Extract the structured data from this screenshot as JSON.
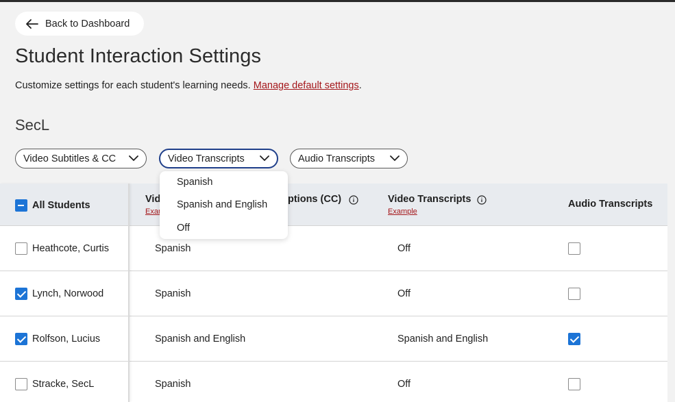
{
  "header": {
    "back_label": "Back to Dashboard",
    "title": "Student Interaction Settings",
    "subtitle": "Customize settings for each student's learning needs. ",
    "manage_link": "Manage default settings",
    "subtitle_end": "."
  },
  "section": {
    "name": "SecL"
  },
  "filters": [
    {
      "label": "Video Subtitles & CC"
    },
    {
      "label": "Video Transcripts"
    },
    {
      "label": "Audio Transcripts"
    }
  ],
  "dropdown": {
    "options": [
      "Spanish",
      "Spanish and English",
      "Off"
    ]
  },
  "table": {
    "all_students_label": "All Students",
    "columns": {
      "subtitles_visible": "Vid",
      "subtitles_example_visible": "Exam",
      "captions_visible": "ptions (CC)",
      "transcripts": "Video Transcripts",
      "transcripts_example": "Example",
      "audio": "Audio Transcripts"
    },
    "rows": [
      {
        "name": "Heathcote, Curtis",
        "checked": false,
        "subtitles": "Spanish",
        "transcripts": "Off",
        "audio": false
      },
      {
        "name": "Lynch, Norwood",
        "checked": true,
        "subtitles": "Spanish",
        "transcripts": "Off",
        "audio": false
      },
      {
        "name": "Rolfson, Lucius",
        "checked": true,
        "subtitles": "Spanish and English",
        "transcripts": "Spanish and English",
        "audio": true
      },
      {
        "name": "Stracke, SecL",
        "checked": false,
        "subtitles": "Spanish",
        "transcripts": "Off",
        "audio": false
      }
    ]
  },
  "colors": {
    "accent": "#1c74d6",
    "link": "#a4161a",
    "header_bg": "#e8ebef",
    "page_bg": "#f2f2f2"
  }
}
